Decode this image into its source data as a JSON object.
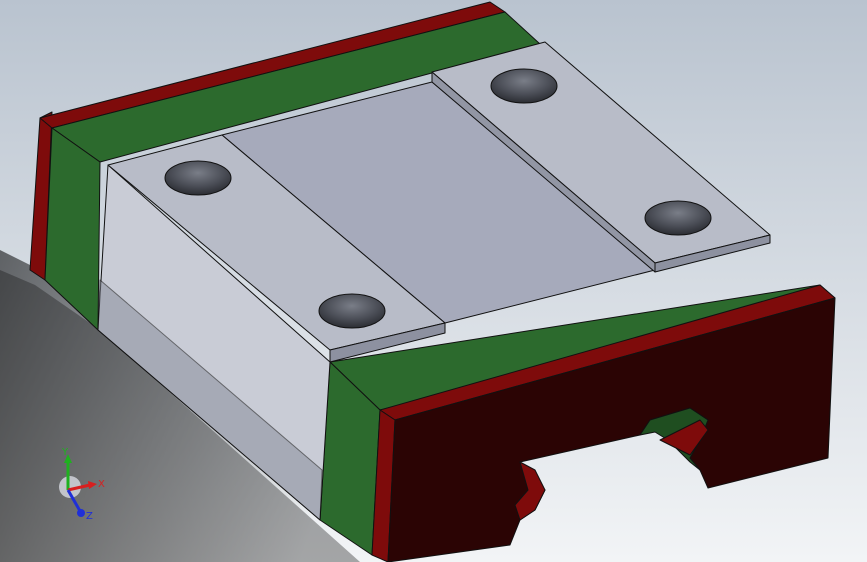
{
  "viewport": {
    "background_top": "#b9c3cf",
    "background_bottom": "#f2f4f6"
  },
  "model": {
    "colors": {
      "rail_red": "#7e0b0b",
      "rail_red_dark": "#3a0505",
      "rail_red_face": "#2b0404",
      "rail_green": "#2c6a2d",
      "rail_green_dark": "#1f4e20",
      "carriage_top": "#a6aabb",
      "carriage_side": "#c9ccd6",
      "carriage_side_dark": "#8a8e9c",
      "plate_top": "#b8bcc8",
      "hole": "#5a5d66",
      "edge": "#111111"
    }
  },
  "triad": {
    "x_label": "X",
    "y_label": "Y",
    "z_label": "Z",
    "x_color": "#d81f1f",
    "y_color": "#1fb11f",
    "z_color": "#1f2fd8"
  }
}
